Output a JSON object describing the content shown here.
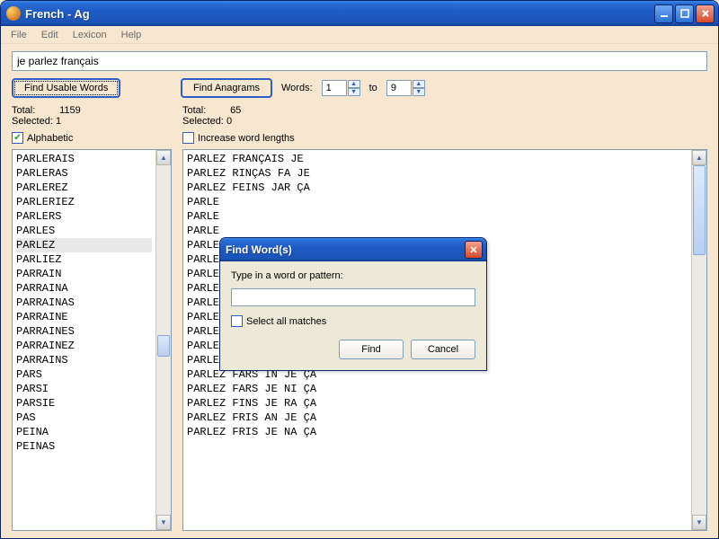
{
  "window": {
    "title": "French - Ag",
    "menus": [
      "File",
      "Edit",
      "Lexicon",
      "Help"
    ]
  },
  "search_value": "je parlez français",
  "buttons": {
    "find_usable": "Find Usable Words",
    "find_anagrams": "Find Anagrams"
  },
  "word_range": {
    "label": "Words:",
    "from": "1",
    "to_label": "to",
    "to": "9"
  },
  "left": {
    "total_label": "Total:",
    "total": "1159",
    "selected_label": "Selected:",
    "selected": "1",
    "checkbox_label": "Alphabetic",
    "checkbox_checked": true,
    "items": [
      "PARLERAIS",
      "PARLERAS",
      "PARLEREZ",
      "PARLERIEZ",
      "PARLERS",
      "PARLES",
      "PARLEZ",
      "PARLIEZ",
      "PARRAIN",
      "PARRAINA",
      "PARRAINAS",
      "PARRAINE",
      "PARRAINES",
      "PARRAINEZ",
      "PARRAINS",
      "PARS",
      "PARSI",
      "PARSIE",
      "PAS",
      "PEINA",
      "PEINAS"
    ],
    "selected_index": 6
  },
  "right": {
    "total_label": "Total:",
    "total": "65",
    "selected_label": "Selected:",
    "selected": "0",
    "checkbox_label": "Increase word lengths",
    "checkbox_checked": false,
    "items": [
      "PARLEZ FRANÇAIS JE",
      "PARLEZ RINÇAS FA JE",
      "PARLEZ FEINS JAR ÇA",
      "PARLE",
      "PARLE",
      "PARLE",
      "PARLE",
      "PARLE",
      "PARLE",
      "PARLE",
      "PARLEZ FINE JARS ÇA",
      "PARLEZ FRIS JEAN ÇA",
      "PARLEZ JAIS NERF ÇA",
      "PARLEZ JARS NIFE ÇA",
      "PARLEZ JEAN RIFS ÇA",
      "PARLEZ FARS IN JE ÇA",
      "PARLEZ FARS JE NI ÇA",
      "PARLEZ FINS JE RA ÇA",
      "PARLEZ FRIS AN JE ÇA",
      "PARLEZ FRIS JE NA ÇA"
    ]
  },
  "dialog": {
    "title": "Find Word(s)",
    "prompt": "Type in a word or pattern:",
    "input_value": "",
    "select_all_label": "Select all matches",
    "select_all_checked": false,
    "find": "Find",
    "cancel": "Cancel"
  }
}
